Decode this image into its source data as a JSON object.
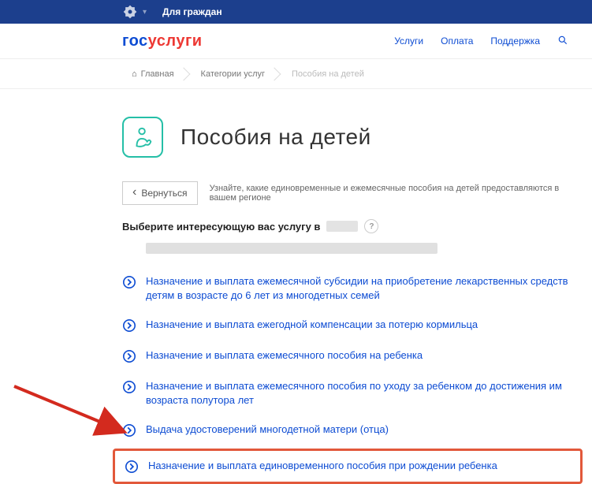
{
  "topbar": {
    "audience": "Для граждан"
  },
  "nav": {
    "services": "Услуги",
    "pay": "Оплата",
    "support": "Поддержка"
  },
  "crumbs": {
    "home": "Главная",
    "cat": "Категории услуг",
    "current": "Пособия на детей"
  },
  "title": "Пособия на детей",
  "back": "Вернуться",
  "intro": "Узнайте, какие единовременные и ежемесячные пособия на детей предоставляются в вашем регионе",
  "pick": "Выберите интересующую вас услугу в",
  "services": [
    "Назначение и выплата ежемесячной субсидии на приобретение лекарственных средств детям в возрасте до 6 лет из многодетных семей",
    "Назначение и выплата ежегодной компенсации за потерю кормильца",
    "Назначение и выплата ежемесячного пособия на ребенка",
    "Назначение и выплата ежемесячного пособия по уходу за ребенком до достижения им возраста полутора лет",
    "Выдача удостоверений многодетной матери (отца)",
    "Назначение и выплата единовременного пособия при рождении ребенка"
  ]
}
